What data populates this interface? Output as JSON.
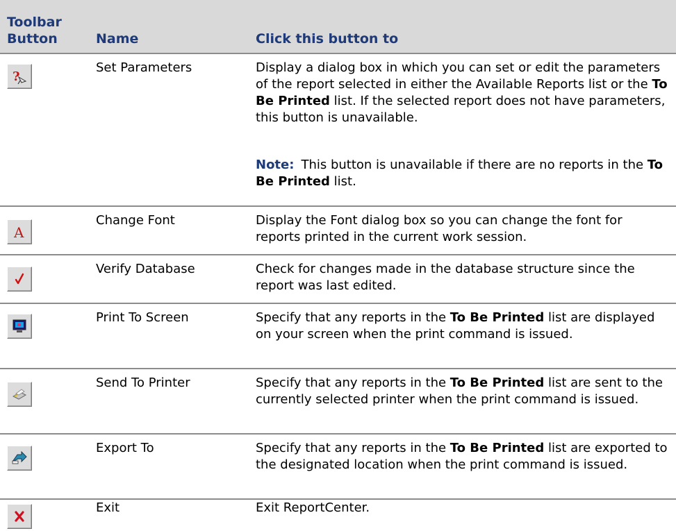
{
  "header": {
    "col_button": "Toolbar Button",
    "col_button_line1": "Toolbar",
    "col_button_line2": "Button",
    "col_name": "Name",
    "col_desc": "Click this button to"
  },
  "rows": [
    {
      "icon": "set-parameters-icon",
      "name": "Set Parameters",
      "desc_parts": [
        "Display a dialog box in which you can set or edit the parameters of the report selected in either the Available Reports list or the ",
        "To Be Printed",
        " list. If the selected report does not have parameters, this button is unavailable."
      ],
      "note_label": "Note:",
      "note_parts": [
        "This button is unavailable if there are no reports in the ",
        "To Be Printed",
        " list."
      ]
    },
    {
      "icon": "change-font-icon",
      "name": "Change Font",
      "desc": "Display the Font dialog box so you can change the font for reports printed in the current work session."
    },
    {
      "icon": "verify-database-icon",
      "name": "Verify Database",
      "desc": "Check for changes made in the database structure since the report was last edited."
    },
    {
      "icon": "print-to-screen-icon",
      "name": "Print To Screen",
      "desc_parts": [
        "Specify that any reports in the ",
        "To Be Printed",
        " list are displayed on your screen when the print command is issued."
      ]
    },
    {
      "icon": "send-to-printer-icon",
      "name": "Send To Printer",
      "desc_parts": [
        "Specify that any reports in the ",
        "To Be Printed",
        " list are sent to the currently selected printer when the print command is issued."
      ]
    },
    {
      "icon": "export-to-icon",
      "name": "Export To",
      "desc_parts": [
        "Specify that any reports in the ",
        "To Be Printed",
        " list are exported to the designated location when the print command is issued."
      ]
    },
    {
      "icon": "exit-icon",
      "name": "Exit",
      "desc": "Exit ReportCenter."
    }
  ]
}
